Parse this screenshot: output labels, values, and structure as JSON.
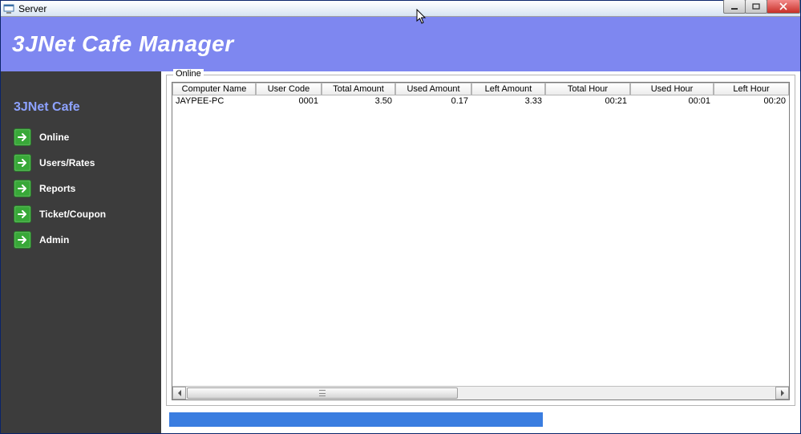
{
  "window": {
    "title": "Server"
  },
  "banner": {
    "title": "3JNet Cafe Manager"
  },
  "sidebar": {
    "title": "3JNet Cafe",
    "items": [
      {
        "label": "Online"
      },
      {
        "label": "Users/Rates"
      },
      {
        "label": "Reports"
      },
      {
        "label": "Ticket/Coupon"
      },
      {
        "label": "Admin"
      }
    ]
  },
  "main": {
    "group_title": "Online",
    "columns": [
      "Computer Name",
      "User Code",
      "Total Amount",
      "Used Amount",
      "Left Amount",
      "Total Hour",
      "Used Hour",
      "Left Hour"
    ],
    "rows": [
      {
        "computer_name": "JAYPEE-PC",
        "user_code": "0001",
        "total_amount": "3.50",
        "used_amount": "0.17",
        "left_amount": "3.33",
        "total_hour": "00:21",
        "used_hour": "00:01",
        "left_hour": "00:20"
      }
    ]
  }
}
